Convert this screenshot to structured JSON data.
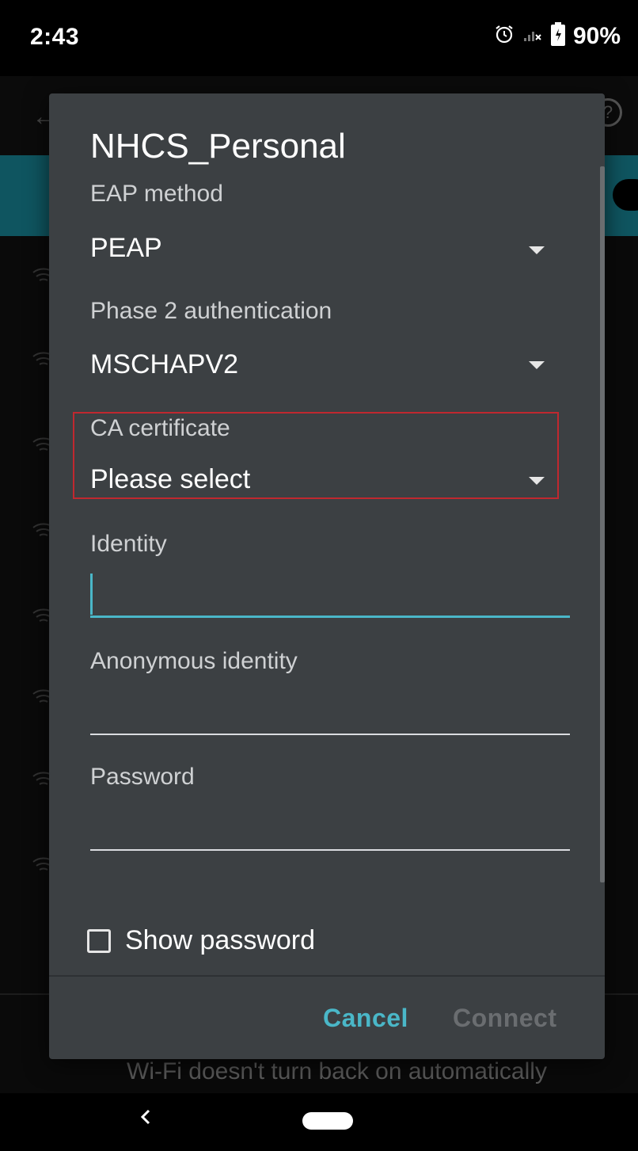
{
  "status_bar": {
    "time": "2:43",
    "battery": "90%",
    "icons": [
      "alarm-icon",
      "no-signal-icon",
      "battery-icon"
    ]
  },
  "background_screen": {
    "footer_text": "Wi-Fi doesn't turn back on automatically"
  },
  "dialog": {
    "title": "NHCS_Personal",
    "fields": {
      "eap_method": {
        "label": "EAP method",
        "value": "PEAP"
      },
      "phase2": {
        "label": "Phase 2 authentication",
        "value": "MSCHAPV2"
      },
      "ca_certificate": {
        "label": "CA certificate",
        "value": "Please select"
      },
      "identity": {
        "label": "Identity",
        "value": ""
      },
      "anonymous_identity": {
        "label": "Anonymous identity",
        "value": ""
      },
      "password": {
        "label": "Password",
        "value": ""
      }
    },
    "show_password": {
      "label": "Show password",
      "checked": false
    },
    "buttons": {
      "cancel": "Cancel",
      "connect": "Connect"
    }
  },
  "colors": {
    "dialog_bg": "#3c4043",
    "accent": "#4ab7c8",
    "highlight_border": "#c0282f",
    "disabled_text": "#6a6d70"
  }
}
